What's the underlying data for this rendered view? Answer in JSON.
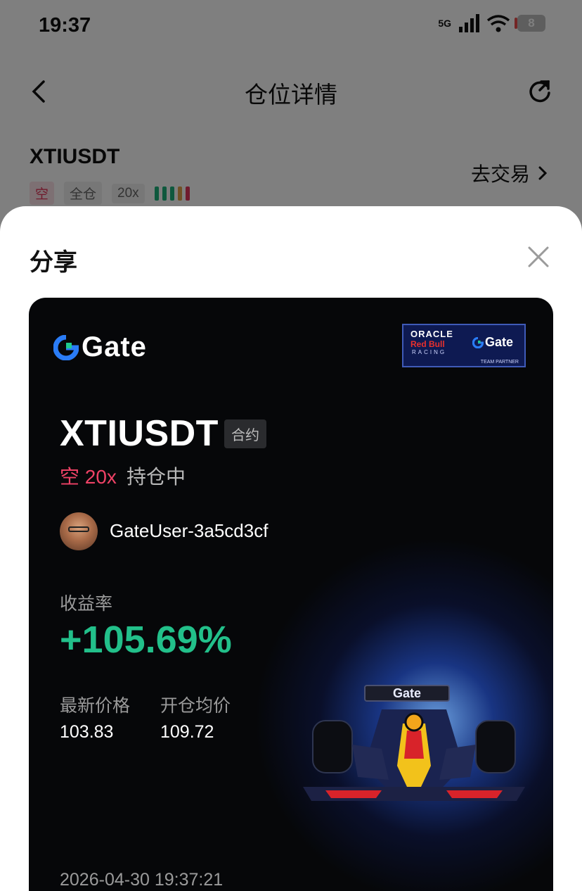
{
  "status_bar": {
    "time": "19:37",
    "network": "5G",
    "battery": "8"
  },
  "nav": {
    "title": "仓位详情"
  },
  "position": {
    "symbol": "XTIUSDT",
    "side_tag": "空",
    "margin_tag": "全仓",
    "leverage_tag": "20x",
    "goto_trade": "去交易",
    "level_bar_colors": [
      "#1db07a",
      "#1db07a",
      "#1db07a",
      "#e0a24a",
      "#e0365a"
    ]
  },
  "share_sheet": {
    "title": "分享",
    "card": {
      "brand": "Gate",
      "partner": {
        "line1": "ORACLE",
        "line2": "Red Bull",
        "line3": "RACING",
        "brand": "Gate",
        "tag": "TEAM PARTNER"
      },
      "symbol": "XTIUSDT",
      "contract_tag": "合约",
      "side": "空 20x",
      "status": "持仓中",
      "username": "GateUser-3a5cd3cf",
      "roi_label": "收益率",
      "roi_value": "+105.69%",
      "latest_price_label": "最新价格",
      "latest_price": "103.83",
      "entry_price_label": "开仓均价",
      "entry_price": "109.72",
      "datetime": "2026-04-30 19:37:21",
      "car_text": "Gate"
    }
  },
  "colors": {
    "positive": "#22c08a",
    "short": "#ef4266",
    "card_bg": "#060709",
    "brand_blue": "#2a7cf6"
  }
}
